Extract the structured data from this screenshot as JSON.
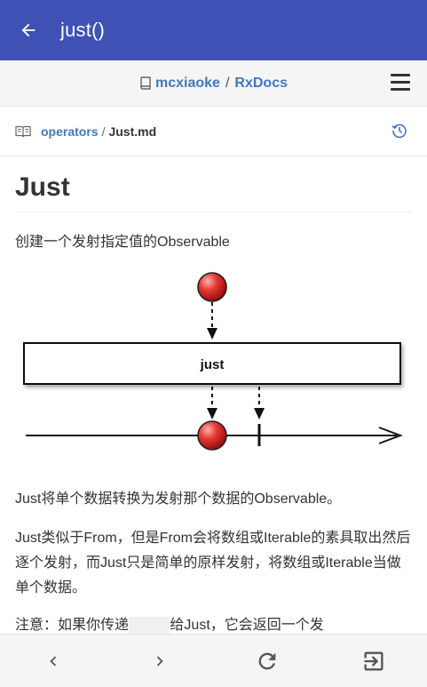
{
  "appbar": {
    "title": "just()",
    "back_icon": "arrow-left-icon"
  },
  "repo": {
    "owner": "mcxiaoke",
    "separator": "/",
    "name": "RxDocs"
  },
  "file": {
    "folder": "operators",
    "separator": "/",
    "name": "Just.md"
  },
  "doc": {
    "heading": "Just",
    "intro": "创建一个发射指定值的Observable",
    "diagram": {
      "box_label": "just"
    },
    "para1": "Just将单个数据转换为发射那个数据的Observable。",
    "para2": "Just类似于From，但是From会将数组或Iterable的素具取出然后逐个发射，而Just只是简单的原样发射，将数组或Iterable当做单个数据。",
    "para3_before": "注意：如果你传递",
    "para3_code": "null",
    "para3_after": "给Just，它会返回一个发"
  },
  "bottom_nav": [
    "chevron-left-icon",
    "chevron-right-icon",
    "refresh-icon",
    "exit-icon"
  ],
  "colors": {
    "primary": "#3f51b5",
    "link": "#4078c0",
    "marble": "#e53935"
  }
}
